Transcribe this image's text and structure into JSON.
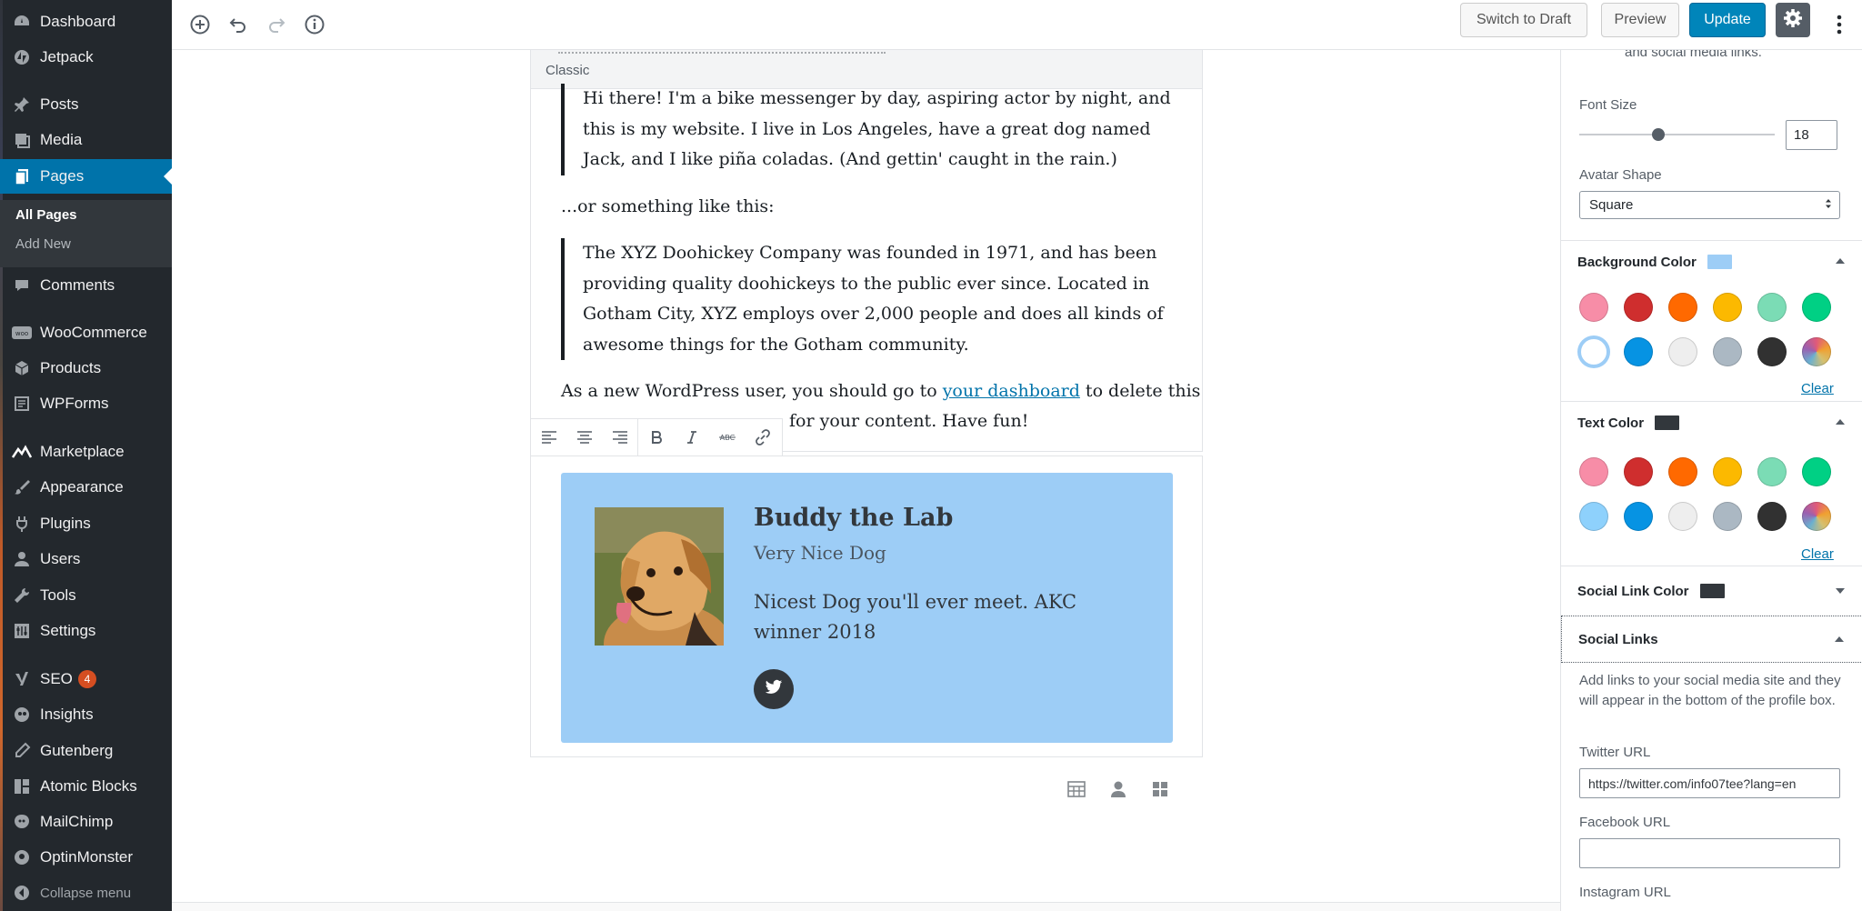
{
  "admin_menu": {
    "items": [
      {
        "id": "dashboard",
        "label": "Dashboard",
        "icon": "dashboard-icon"
      },
      {
        "id": "jetpack",
        "label": "Jetpack",
        "icon": "jetpack-icon"
      },
      {
        "id": "posts",
        "label": "Posts",
        "icon": "pin-icon"
      },
      {
        "id": "media",
        "label": "Media",
        "icon": "media-icon"
      },
      {
        "id": "pages",
        "label": "Pages",
        "icon": "pages-icon",
        "active": true
      },
      {
        "id": "comments",
        "label": "Comments",
        "icon": "comment-icon"
      },
      {
        "id": "woocommerce",
        "label": "WooCommerce",
        "icon": "woo-icon"
      },
      {
        "id": "products",
        "label": "Products",
        "icon": "box-icon"
      },
      {
        "id": "wpforms",
        "label": "WPForms",
        "icon": "form-icon"
      },
      {
        "id": "marketplace",
        "label": "Marketplace",
        "icon": "chart-icon"
      },
      {
        "id": "appearance",
        "label": "Appearance",
        "icon": "brush-icon"
      },
      {
        "id": "plugins",
        "label": "Plugins",
        "icon": "plug-icon"
      },
      {
        "id": "users",
        "label": "Users",
        "icon": "user-icon"
      },
      {
        "id": "tools",
        "label": "Tools",
        "icon": "wrench-icon"
      },
      {
        "id": "settings",
        "label": "Settings",
        "icon": "settings-icon"
      },
      {
        "id": "seo",
        "label": "SEO",
        "icon": "yoast-icon",
        "badge": "4"
      },
      {
        "id": "insights",
        "label": "Insights",
        "icon": "insights-icon"
      },
      {
        "id": "gutenberg",
        "label": "Gutenberg",
        "icon": "pencil-icon"
      },
      {
        "id": "atomic-blocks",
        "label": "Atomic Blocks",
        "icon": "blocks-icon"
      },
      {
        "id": "mailchimp",
        "label": "MailChimp",
        "icon": "mailchimp-icon"
      },
      {
        "id": "optinmonster",
        "label": "OptinMonster",
        "icon": "monster-icon"
      }
    ],
    "submenu": {
      "all_pages": "All Pages",
      "add_new": "Add New"
    },
    "collapse": "Collapse menu"
  },
  "toolbar": {
    "switch_to_draft": "Switch to Draft",
    "preview": "Preview",
    "update": "Update"
  },
  "editor": {
    "classic_label": "Classic",
    "quote1": "Hi there! I'm a bike messenger by day, aspiring actor by night, and this is my website. I live in Los Angeles, have a great dog named Jack, and I like piña coladas. (And gettin' caught in the rain.)",
    "para1": "...or something like this:",
    "quote2": "The XYZ Doohickey Company was founded in 1971, and has been providing quality doohickeys to the public ever since. Located in Gotham City, XYZ employs over 2,000 people and does all kinds of awesome things for the Gotham community.",
    "para2_before": "As a new WordPress user, you should go to ",
    "para2_link": "your dashboard",
    "para2_after": " to delete this",
    "para2_line2": "for your content. Have fun!",
    "profile": {
      "name": "Buddy the Lab",
      "title": "Very Nice Dog",
      "bio": "Nicest Dog you'll ever meet. AKC winner 2018",
      "background": "#9dcdf6"
    }
  },
  "settings": {
    "cut_text": "and social media links.",
    "font_size_label": "Font Size",
    "font_size_value": "18",
    "avatar_shape_label": "Avatar Shape",
    "avatar_shape_value": "Square",
    "background_color_label": "Background Color",
    "background_color_swatch": "#9dcdf6",
    "text_color_label": "Text Color",
    "text_color_swatch": "#32373c",
    "social_link_color_label": "Social Link Color",
    "social_link_color_swatch": "#32373c",
    "clear_label": "Clear",
    "social_links_label": "Social Links",
    "social_links_help": "Add links to your social media site and they will appear in the bottom of the profile box.",
    "twitter_label": "Twitter URL",
    "twitter_value": "https://twitter.com/info07tee?lang=en",
    "facebook_label": "Facebook URL",
    "facebook_value": "",
    "instagram_label": "Instagram URL",
    "palette": [
      "#f78da7",
      "#cf2e2e",
      "#ff6900",
      "#fcb900",
      "#7bdcb5",
      "#00d084",
      "#8ed1fc",
      "#0693e3",
      "#eeeeee",
      "#abb8c3",
      "#313131",
      "#d4a76a"
    ]
  }
}
